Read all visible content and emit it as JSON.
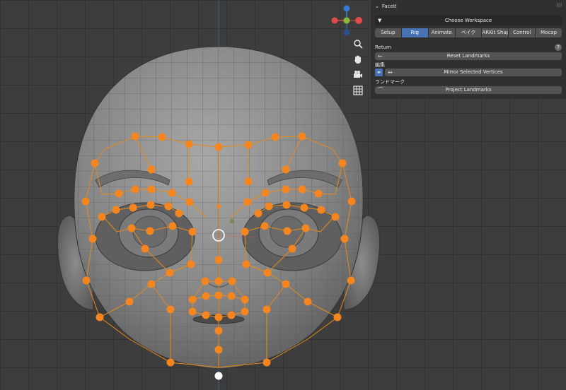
{
  "panel": {
    "title": "FaceIt",
    "workspace_label": "Choose Workspace",
    "tabs": [
      {
        "label": "Setup",
        "active": false
      },
      {
        "label": "Rig",
        "active": true
      },
      {
        "label": "Animate",
        "active": false
      },
      {
        "label": "ベイク",
        "active": false
      },
      {
        "label": "ARKit Shapes",
        "active": false
      },
      {
        "label": "Control",
        "active": false
      },
      {
        "label": "Mocap",
        "active": false
      }
    ],
    "return_label": "Return",
    "reset_landmarks": "Reset Landmarks",
    "edit_label": "編集",
    "mirror_selected": "Mirror Selected Vertices",
    "landmarks_label": "ランドマーク",
    "project_landmarks": "Project Landmarks",
    "help_glyph": "?"
  },
  "viewport_tools": [
    "zoom-icon",
    "hand-icon",
    "camera-icon",
    "grid-icon"
  ],
  "gizmo": {
    "axes": [
      "x",
      "y",
      "z"
    ],
    "colors": {
      "x": "#e04a4a",
      "y": "#8ab839",
      "z": "#3a78d6"
    }
  },
  "colors": {
    "accent": "#4772b3",
    "landmark": "#f5861f",
    "landmark_line": "#e88a1a",
    "head_fill": "#8a8a8a"
  }
}
